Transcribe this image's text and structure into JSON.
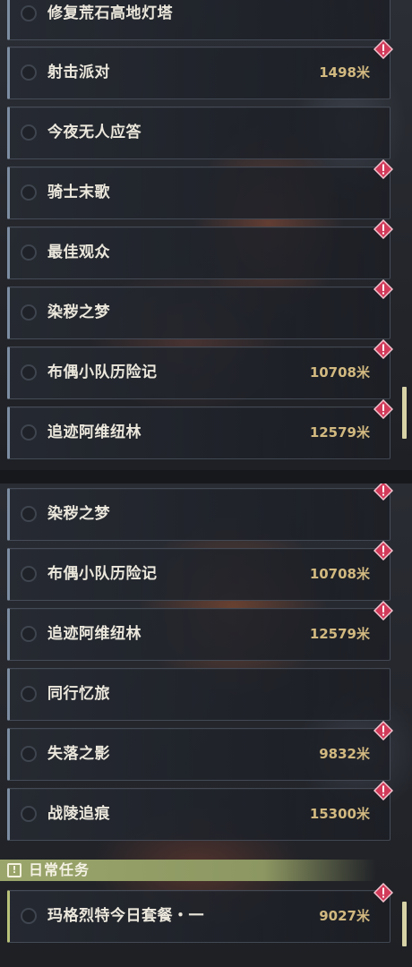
{
  "panel_a": {
    "quests": [
      {
        "name": "修复荒石高地灯塔",
        "distance": "",
        "alert": false
      },
      {
        "name": "射击派对",
        "distance": "1498米",
        "alert": true
      },
      {
        "name": "今夜无人应答",
        "distance": "",
        "alert": false
      },
      {
        "name": "骑士末歌",
        "distance": "",
        "alert": true
      },
      {
        "name": "最佳观众",
        "distance": "",
        "alert": true
      },
      {
        "name": "染秽之梦",
        "distance": "",
        "alert": true
      },
      {
        "name": "布偶小队历险记",
        "distance": "10708米",
        "alert": true
      },
      {
        "name": "追迹阿维纽林",
        "distance": "12579米",
        "alert": true
      }
    ]
  },
  "panel_b": {
    "quests": [
      {
        "name": "染秽之梦",
        "distance": "",
        "alert": true
      },
      {
        "name": "布偶小队历险记",
        "distance": "10708米",
        "alert": true
      },
      {
        "name": "追迹阿维纽林",
        "distance": "12579米",
        "alert": true
      },
      {
        "name": "同行忆旅",
        "distance": "",
        "alert": false
      },
      {
        "name": "失落之影",
        "distance": "9832米",
        "alert": true
      },
      {
        "name": "战陵追痕",
        "distance": "15300米",
        "alert": true
      }
    ],
    "daily_section": {
      "icon": "!",
      "title": "日常任务",
      "quests": [
        {
          "name": "玛格烈特今日套餐・一",
          "distance": "9027米",
          "alert": true
        }
      ]
    }
  },
  "icons": {
    "alert": "alert-diamond-icon",
    "radio": "radio-circle-icon",
    "section": "exclamation-box-icon"
  },
  "colors": {
    "quest_text": "#ebe7dc",
    "distance_text": "#d2b980",
    "alert_red": "#d23a5a",
    "daily_accent": "#9aa56b",
    "scrollbar": "#d7d2a6"
  }
}
